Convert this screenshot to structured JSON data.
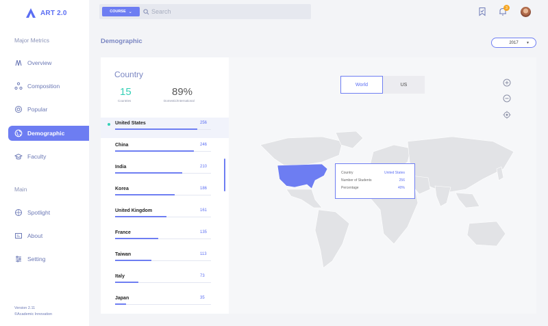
{
  "app": {
    "name": "ART 2.0"
  },
  "sidebar": {
    "section_major": "Major Metrics",
    "items_major": [
      {
        "label": "Overview",
        "icon": "overview-icon"
      },
      {
        "label": "Composition",
        "icon": "composition-icon"
      },
      {
        "label": "Popular",
        "icon": "popular-icon"
      },
      {
        "label": "Demographic",
        "icon": "globe-icon",
        "active": true
      },
      {
        "label": "Faculty",
        "icon": "faculty-icon"
      }
    ],
    "section_main": "Main",
    "items_main": [
      {
        "label": "Spotlight",
        "icon": "spotlight-icon"
      },
      {
        "label": "About",
        "icon": "about-icon"
      },
      {
        "label": "Setting",
        "icon": "settings-icon"
      }
    ],
    "version": "Version 2.11",
    "credit": "©Academic Innovation"
  },
  "topbar": {
    "course_label": "COURSE",
    "search_placeholder": "Search",
    "notification_count": "3"
  },
  "page": {
    "title": "Demographic",
    "year": "2017"
  },
  "country_panel": {
    "title": "Country",
    "countries_count": "15",
    "countries_label": "Countries",
    "percent": "89%",
    "percent_label": "Domestic/International",
    "max_value": 256,
    "rows": [
      {
        "name": "United States",
        "value": 256,
        "selected": true
      },
      {
        "name": "China",
        "value": 246
      },
      {
        "name": "India",
        "value": 210
      },
      {
        "name": "Korea",
        "value": 186
      },
      {
        "name": "United Kingdom",
        "value": 161
      },
      {
        "name": "France",
        "value": 135
      },
      {
        "name": "Taiwan",
        "value": 113
      },
      {
        "name": "Italy",
        "value": 73
      },
      {
        "name": "Japan",
        "value": 35
      }
    ]
  },
  "map": {
    "toggle_world": "World",
    "toggle_us": "US",
    "tooltip": {
      "country_label": "Country",
      "country_value": "United States",
      "students_label": "Number of Students",
      "students_value": "256",
      "percentage_label": "Percentage",
      "percentage_value": "40%"
    }
  },
  "colors": {
    "accent": "#6d7df2",
    "teal": "#34d0b6",
    "badge": "#f5a623"
  }
}
